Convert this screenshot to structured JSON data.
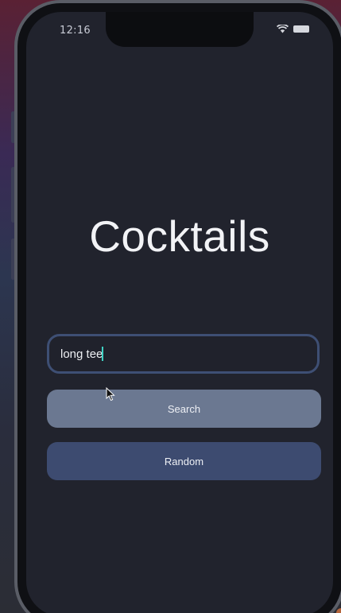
{
  "status_bar": {
    "time": "12:16",
    "icons": [
      "wifi-icon",
      "battery-icon"
    ]
  },
  "app": {
    "title": "Cocktails"
  },
  "search": {
    "value": "long tee",
    "placeholder": ""
  },
  "buttons": {
    "search_label": "Search",
    "random_label": "Random"
  },
  "colors": {
    "screen_background": "#21232d",
    "input_border": "#3e4f74",
    "search_button": "#6b7891",
    "random_button": "#3d4b70",
    "caret": "#3fd1c4"
  }
}
